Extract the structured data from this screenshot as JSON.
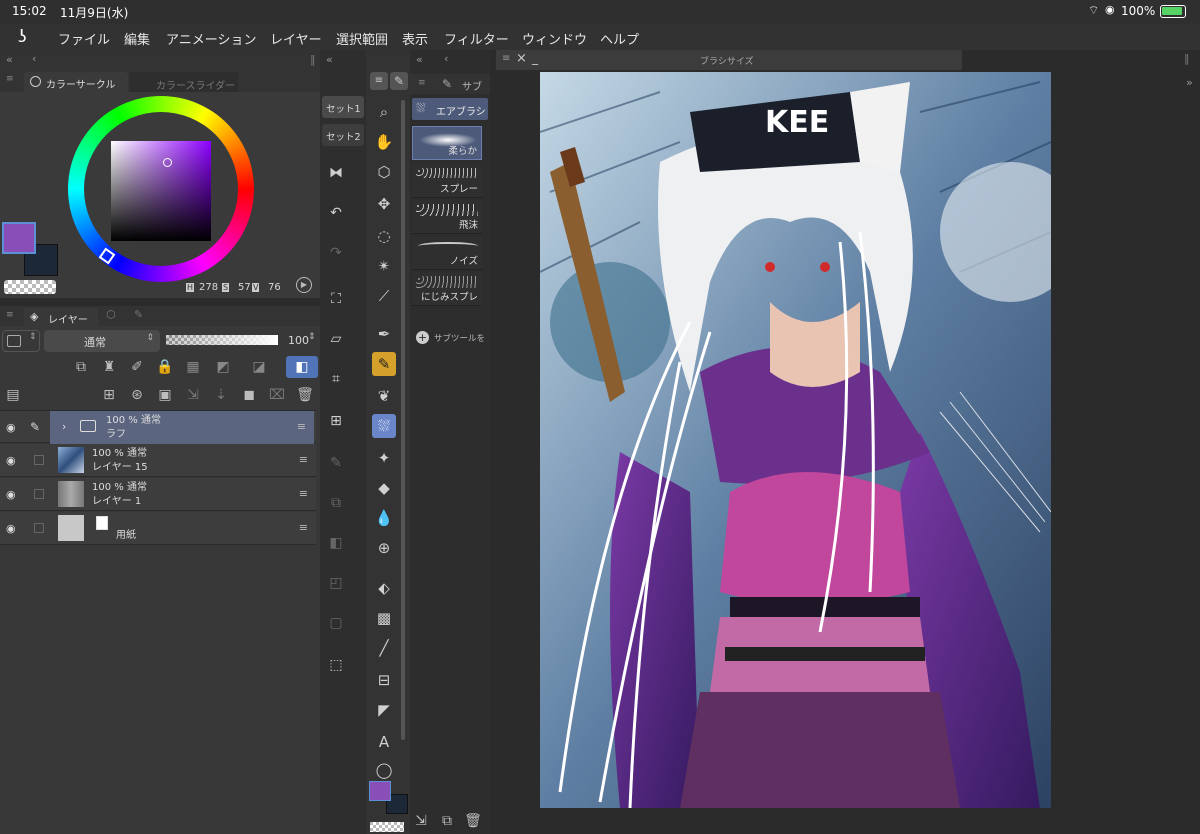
{
  "status": {
    "time": "15:02",
    "date": "11月9日(水)",
    "battery": "100%"
  },
  "menu": [
    "ファイル",
    "編集",
    "アニメーション",
    "レイヤー",
    "選択範囲",
    "表示",
    "フィルター",
    "ウィンドウ",
    "ヘルプ"
  ],
  "color_panel": {
    "tab_active": "カラーサークル",
    "tab_inactive": "カラースライダー",
    "h_label": "H",
    "h_value": "278",
    "s_label": "S",
    "s_value": "57",
    "v_label": "V",
    "v_value": "76",
    "main_color": "#8a4fb6",
    "sub_color": "#1c2838"
  },
  "layer_panel": {
    "tab": "レイヤー",
    "blend_mode": "通常",
    "opacity": "100",
    "layers": [
      {
        "line1": "100 % 通常",
        "line2": "ラフ",
        "type": "folder"
      },
      {
        "line1": "100 % 通常",
        "line2": "レイヤー 15",
        "type": "image"
      },
      {
        "line1": "100 % 通常",
        "line2": "レイヤー 1",
        "type": "gray"
      },
      {
        "line1": "",
        "line2": "用紙",
        "type": "paper"
      }
    ]
  },
  "command_bar": {
    "set1": "セット1",
    "set2": "セット2"
  },
  "sub_tool": {
    "tab": "サブ",
    "header": "エアブラシ",
    "brushes": [
      "柔らか",
      "スプレー",
      "飛沫",
      "ノイズ",
      "にじみスプレ"
    ],
    "add_label": "サブツールを"
  },
  "canvas": {
    "title": "ブラシサイズ",
    "hat_text": "KEE"
  }
}
